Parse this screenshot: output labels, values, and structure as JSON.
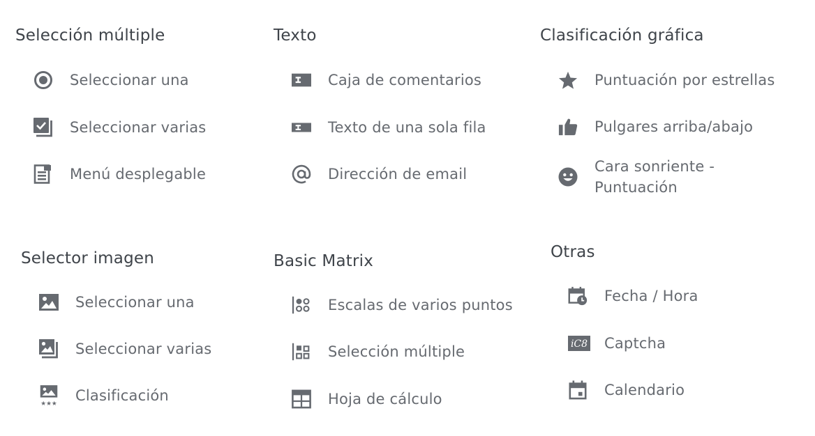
{
  "groups": {
    "multiple_choice": {
      "title": "Selección múltiple",
      "items": [
        {
          "label": "Seleccionar una",
          "icon": "radio-selected-icon"
        },
        {
          "label": "Seleccionar varias",
          "icon": "checkbox-multi-icon"
        },
        {
          "label": "Menú desplegable",
          "icon": "dropdown-menu-icon"
        }
      ]
    },
    "text": {
      "title": "Texto",
      "items": [
        {
          "label": "Caja de comentarios",
          "icon": "text-box-icon"
        },
        {
          "label": "Texto de una sola fila",
          "icon": "single-line-text-icon"
        },
        {
          "label": "Dirección de email",
          "icon": "at-sign-icon"
        }
      ]
    },
    "graphic_rating": {
      "title": "Clasificación gráfica",
      "items": [
        {
          "label": "Puntuación por estrellas",
          "icon": "star-icon"
        },
        {
          "label": "Pulgares arriba/abajo",
          "icon": "thumbs-up-icon"
        },
        {
          "label_line1": "Cara sonriente -",
          "label_line2": "Puntuación",
          "icon": "smiley-icon"
        }
      ]
    },
    "image_selector": {
      "title": "Selector imagen",
      "items": [
        {
          "label": "Seleccionar una",
          "icon": "image-icon"
        },
        {
          "label": "Seleccionar varias",
          "icon": "image-multi-icon"
        },
        {
          "label": "Clasificación",
          "icon": "image-rating-icon"
        }
      ]
    },
    "basic_matrix": {
      "title": "Basic Matrix",
      "items": [
        {
          "label": "Escalas de varios puntos",
          "icon": "matrix-scale-icon"
        },
        {
          "label": "Selección múltiple",
          "icon": "matrix-multi-icon"
        },
        {
          "label": "Hoja de cálculo",
          "icon": "spreadsheet-icon"
        }
      ]
    },
    "others": {
      "title": "Otras",
      "items": [
        {
          "label": "Fecha / Hora",
          "icon": "calendar-clock-icon"
        },
        {
          "label": "Captcha",
          "icon": "captcha-icon",
          "icon_text": "iC8"
        },
        {
          "label": "Calendario",
          "icon": "calendar-icon"
        }
      ]
    }
  },
  "colors": {
    "icon": "#666a70",
    "title": "#3f444a",
    "label": "#666a70"
  }
}
